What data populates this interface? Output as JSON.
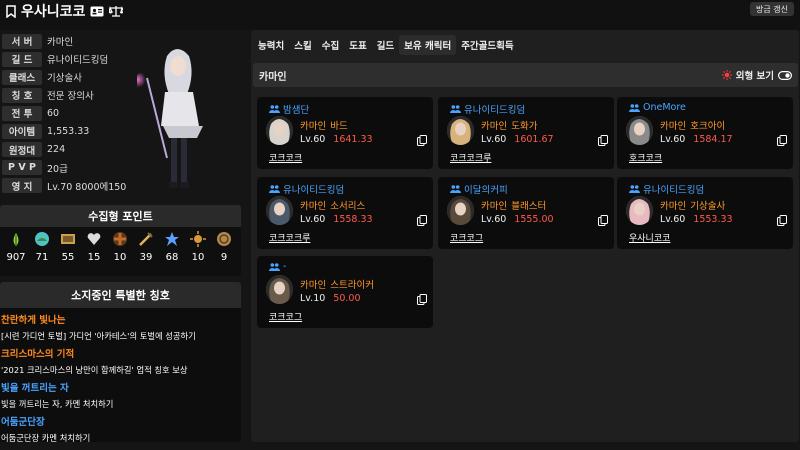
{
  "header": {
    "name": "우사니코코",
    "refresh_label": "방금 갱신"
  },
  "info": [
    {
      "label": "서 버",
      "value": "카마인"
    },
    {
      "label": "길 드",
      "value": "유나이티드킹덤"
    },
    {
      "label": "클래스",
      "value": "기상술사"
    },
    {
      "label": "칭 호",
      "value": "전문 장의사"
    },
    {
      "label": "전 투",
      "value": "60"
    },
    {
      "label": "아이템",
      "value": "1,553.33"
    },
    {
      "label": "원정대",
      "value": "224"
    },
    {
      "label": "P V P",
      "value": "20급"
    },
    {
      "label": "영 지",
      "value": "Lv.70 8000에150"
    }
  ],
  "collect": {
    "title": "수집형 포인트",
    "items": [
      {
        "icon": "seed-icon",
        "count": "907",
        "color": "#8fcf3a"
      },
      {
        "icon": "island-icon",
        "count": "71",
        "color": "#4fc1c4"
      },
      {
        "icon": "painting-icon",
        "count": "55",
        "color": "#c7a24a"
      },
      {
        "icon": "heart-icon",
        "count": "15",
        "color": "#dddddd"
      },
      {
        "icon": "cross-icon",
        "count": "10",
        "color": "#c46a2a"
      },
      {
        "icon": "sword-icon",
        "count": "39",
        "color": "#e0b55a"
      },
      {
        "icon": "leaf-icon",
        "count": "68",
        "color": "#5aa0ff"
      },
      {
        "icon": "sun-icon",
        "count": "10",
        "color": "#d89a3a"
      },
      {
        "icon": "coin-icon",
        "count": "9",
        "color": "#b08a4a"
      }
    ]
  },
  "titles": {
    "title": "소지중인 특별한 칭호",
    "items": [
      {
        "name": "찬란하게 빛나는",
        "desc": "[시련 가디언 토벌] 가디언 '아카테스'의 토벌에 성공하기",
        "color": "#ff8a1f"
      },
      {
        "name": "크리스마스의 기적",
        "desc": "'2021 크리스마스의 낭만이 함께하길' 업적 칭호 보상",
        "color": "#ff8a1f"
      },
      {
        "name": "빛을 꺼트리는 자",
        "desc": "빛을 꺼트리는 자, 카멘 처치하기",
        "color": "#4aa3ff"
      },
      {
        "name": "어둠군단장",
        "desc": "어둠군단장 카멘 처치하기",
        "color": "#4aa3ff"
      }
    ]
  },
  "tabs": [
    "능력치",
    "스킬",
    "수집",
    "도표",
    "길드",
    "보유 캐릭터",
    "주간골드획득"
  ],
  "active_tab": "보유 캐릭터",
  "server_header": {
    "name": "카마인",
    "view_label": "외형 보기"
  },
  "characters": [
    {
      "guild": "밤샘단",
      "server": "카마인",
      "class": "바드",
      "level": "Lv.60",
      "item_level": "1641.33",
      "nickname": "코크코크",
      "avatar_color": "#d8d4cc"
    },
    {
      "guild": "유나이티드킹덤",
      "server": "카마인",
      "class": "도화가",
      "level": "Lv.60",
      "item_level": "1601.67",
      "nickname": "코크코크루",
      "avatar_color": "#d7b27a"
    },
    {
      "guild": "OneMore",
      "server": "카마인",
      "class": "호크아이",
      "level": "Lv.60",
      "item_level": "1584.17",
      "nickname": "호크코크",
      "avatar_color": "#8a8a8a"
    },
    {
      "guild": "유나이티드킹덤",
      "server": "카마인",
      "class": "소서리스",
      "level": "Lv.60",
      "item_level": "1558.33",
      "nickname": "코크코크루",
      "avatar_color": "#4a5a6a"
    },
    {
      "guild": "이달의커피",
      "server": "카마인",
      "class": "블래스터",
      "level": "Lv.60",
      "item_level": "1555.00",
      "nickname": "코크코그",
      "avatar_color": "#5a4a3a"
    },
    {
      "guild": "유나이티드킹덤",
      "server": "카마인",
      "class": "기상술사",
      "level": "Lv.60",
      "item_level": "1553.33",
      "nickname": "우사니코코",
      "avatar_color": "#e8b9c0"
    },
    {
      "guild": "-",
      "server": "카마인",
      "class": "스트라이커",
      "level": "Lv.10",
      "item_level": "50.00",
      "nickname": "코크코그",
      "avatar_color": "#6a5a4a"
    }
  ]
}
